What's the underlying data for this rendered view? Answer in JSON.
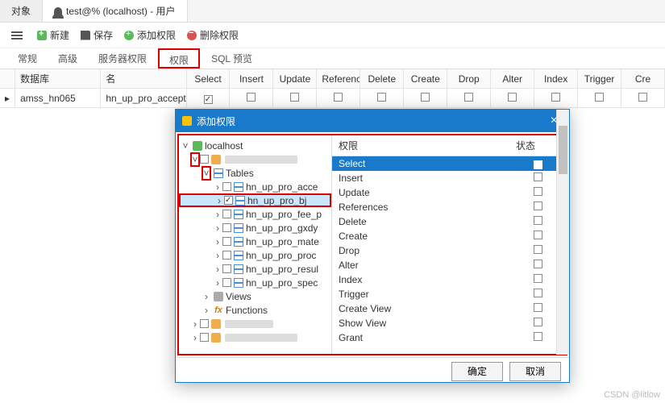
{
  "tabs": {
    "object": "对象",
    "user": "test@% (localhost) - 用户"
  },
  "toolbar": {
    "new": "新建",
    "save": "保存",
    "addPriv": "添加权限",
    "delPriv": "删除权限"
  },
  "subtabs": {
    "general": "常规",
    "advanced": "高级",
    "serverPriv": "服务器权限",
    "priv": "权限",
    "sqlPreview": "SQL 预览"
  },
  "grid": {
    "headers": {
      "db": "数据库",
      "name": "名",
      "select": "Select",
      "insert": "Insert",
      "update": "Update",
      "references": "References",
      "delete": "Delete",
      "create": "Create",
      "drop": "Drop",
      "alter": "Alter",
      "index": "Index",
      "trigger": "Trigger",
      "cr": "Cre"
    },
    "row": {
      "db": "amss_hn065",
      "name": "hn_up_pro_accept"
    }
  },
  "dialog": {
    "title": "添加权限",
    "tree": {
      "root": "localhost",
      "tables": "Tables",
      "items": [
        "hn_up_pro_acce",
        "hn_up_pro_bj",
        "hn_up_pro_fee_p",
        "hn_up_pro_gxdy",
        "hn_up_pro_mate",
        "hn_up_pro_proc",
        "hn_up_pro_resul",
        "hn_up_pro_spec"
      ],
      "views": "Views",
      "functions": "Functions"
    },
    "permHeader": {
      "name": "权限",
      "state": "状态"
    },
    "perms": [
      "Select",
      "Insert",
      "Update",
      "References",
      "Delete",
      "Create",
      "Drop",
      "Alter",
      "Index",
      "Trigger",
      "Create View",
      "Show View",
      "Grant"
    ],
    "ok": "确定",
    "cancel": "取消"
  },
  "watermark": "CSDN @litlow"
}
